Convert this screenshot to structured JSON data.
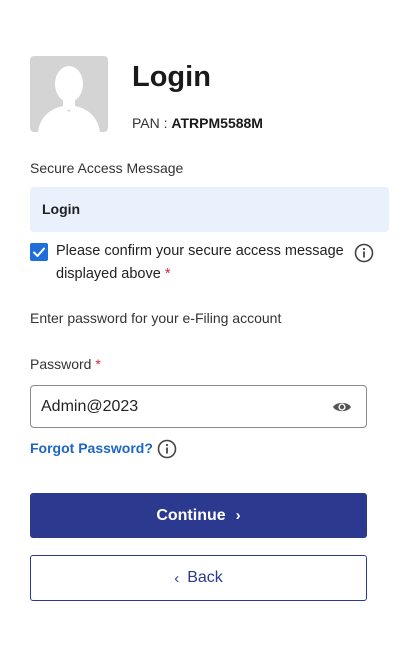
{
  "header": {
    "title": "Login",
    "pan_label": "PAN : ",
    "pan_value": "ATRPM5588M"
  },
  "secure_access": {
    "label": "Secure Access Message",
    "message": "Login"
  },
  "confirm": {
    "checked": true,
    "text": "Please confirm your secure access message displayed above",
    "required_mark": "*"
  },
  "password_section": {
    "instruction": "Enter password for your e-Filing account",
    "label": "Password",
    "required_mark": "*",
    "value": "Admin@2023",
    "forgot_link": "Forgot Password?"
  },
  "buttons": {
    "continue_label": "Continue",
    "back_label": "Back"
  },
  "icons": {
    "avatar": "user-silhouette-icon",
    "info": "info-circle-icon",
    "eye": "eye-icon",
    "checkbox": "check-icon"
  },
  "colors": {
    "primary": "#2b3a8f",
    "link": "#1d66c4",
    "checkbox": "#1e6fd9",
    "message_bg": "#e9f2fc",
    "required": "#d0263b"
  }
}
